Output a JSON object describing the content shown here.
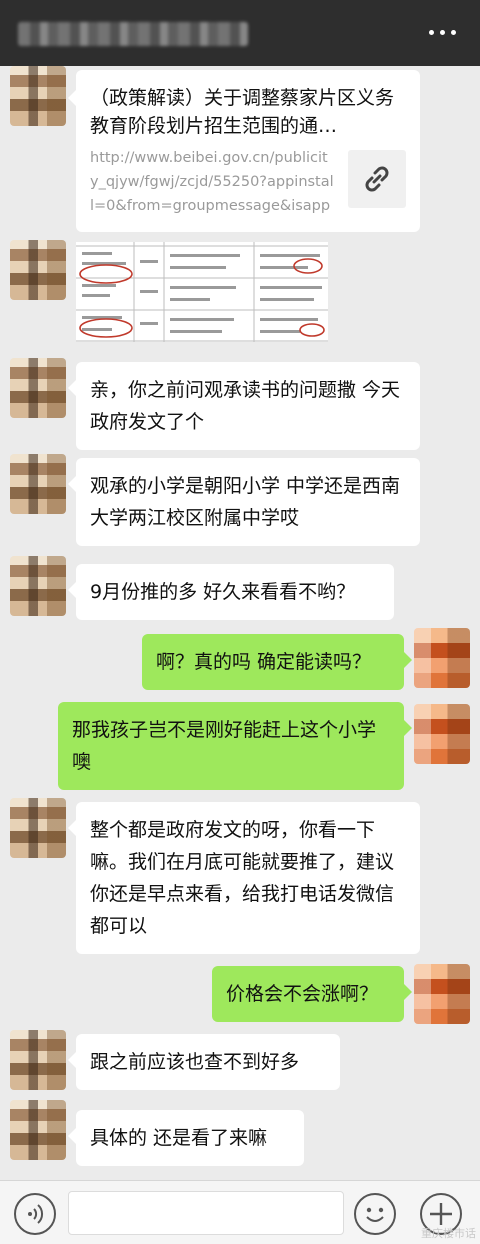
{
  "header": {
    "title": "",
    "more_icon": "more-dots-icon"
  },
  "messages": [
    {
      "type": "link",
      "side": "left",
      "title": "（政策解读）关于调整蔡家片区义务教育阶段划片招生范围的通…",
      "url": "http://www.beibei.gov.cn/publicity_qjyw/fgwj/zcjd/55250?appinstall=0&from=groupmessage&isappi…",
      "icon": "link-icon"
    },
    {
      "type": "image",
      "side": "left",
      "description": "document-screenshot"
    },
    {
      "type": "text",
      "side": "left",
      "text": "亲，你之前问观承读书的问题撒 今天政府发文了个"
    },
    {
      "type": "text",
      "side": "left",
      "text": "观承的小学是朝阳小学 中学还是西南大学两江校区附属中学哎"
    },
    {
      "type": "text",
      "side": "left",
      "text": "9月份推的多 好久来看看不哟？"
    },
    {
      "type": "text",
      "side": "right",
      "text": "啊？真的吗 确定能读吗？"
    },
    {
      "type": "text",
      "side": "right",
      "text": "那我孩子岂不是刚好能赶上这个小学噢"
    },
    {
      "type": "text",
      "side": "left",
      "text": "整个都是政府发文的呀，你看一下嘛。我们在月底可能就要推了，建议你还是早点来看，给我打电话发微信都可以"
    },
    {
      "type": "text",
      "side": "right",
      "text": "价格会不会涨啊？"
    },
    {
      "type": "text",
      "side": "left",
      "text": "跟之前应该也查不到好多"
    },
    {
      "type": "text",
      "side": "left",
      "text": "具体的 还是看了来嘛"
    }
  ],
  "input_bar": {
    "voice_icon": "voice-icon",
    "emoji_icon": "emoji-icon",
    "plus_icon": "plus-icon",
    "watermark": "重庆楼市话"
  },
  "colors": {
    "header_bg": "#2e2e2e",
    "chat_bg": "#ebebeb",
    "bubble_other": "#ffffff",
    "bubble_me": "#9ee85c",
    "url_text": "#9a9a9a"
  }
}
